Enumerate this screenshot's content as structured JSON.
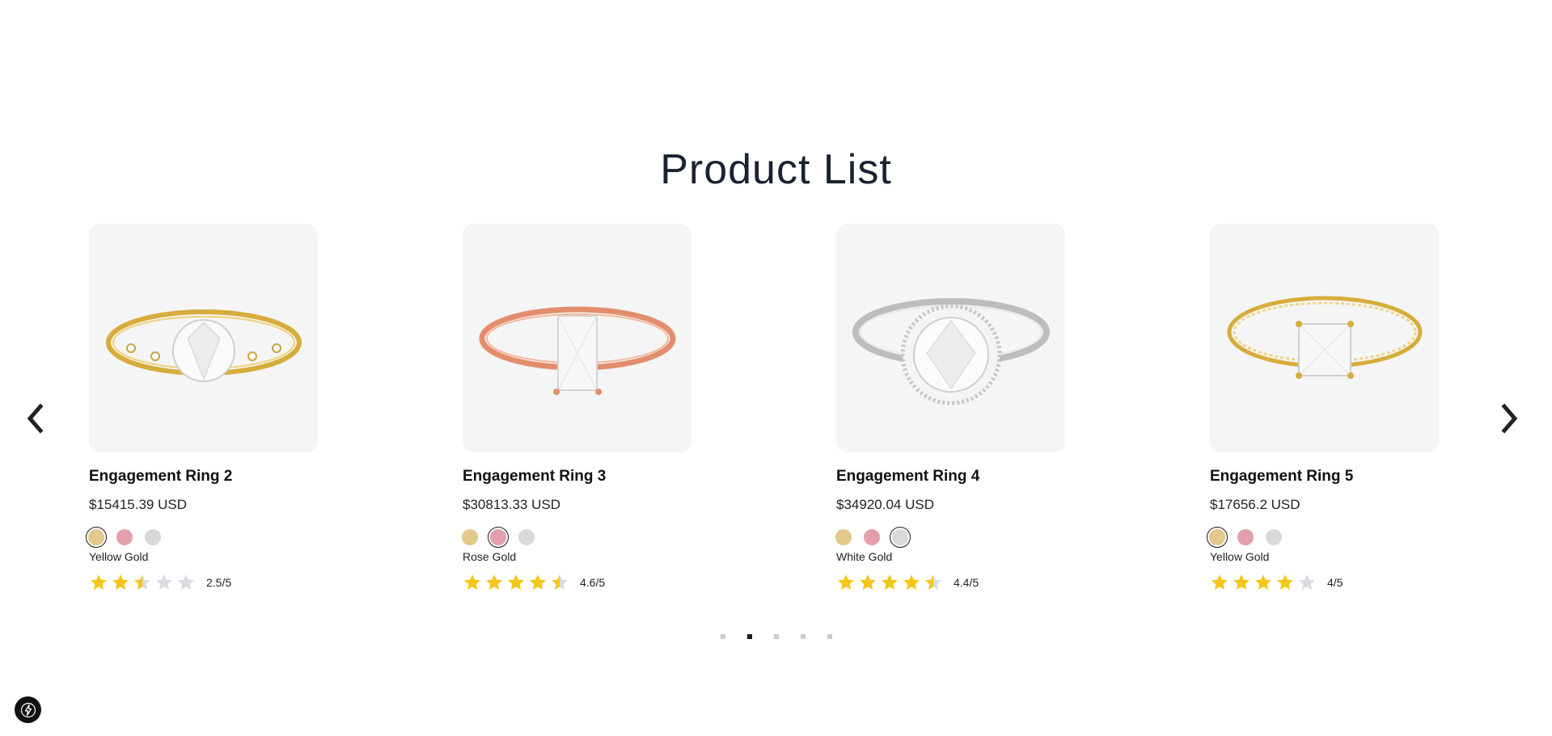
{
  "page": {
    "title": "Product List"
  },
  "colors": {
    "yellow_gold": "#e3c98a",
    "rose_gold": "#e3a0ab",
    "white_gold": "#d9d9d9",
    "star_filled": "#f5c518",
    "star_empty": "#d9dbe3"
  },
  "carousel": {
    "prev_icon": "chevron-left-icon",
    "next_icon": "chevron-right-icon",
    "page_count": 5,
    "active_page": 2
  },
  "products": [
    {
      "name": "Engagement Ring 2",
      "price": "$15415.39 USD",
      "metal_options": [
        "Yellow Gold",
        "Rose Gold",
        "White Gold"
      ],
      "selected_metal": "Yellow Gold",
      "rating": 2.5,
      "rating_text": "2.5/5"
    },
    {
      "name": "Engagement Ring 3",
      "price": "$30813.33 USD",
      "metal_options": [
        "Yellow Gold",
        "Rose Gold",
        "White Gold"
      ],
      "selected_metal": "Rose Gold",
      "rating": 4.6,
      "rating_text": "4.6/5"
    },
    {
      "name": "Engagement Ring 4",
      "price": "$34920.04 USD",
      "metal_options": [
        "Yellow Gold",
        "Rose Gold",
        "White Gold"
      ],
      "selected_metal": "White Gold",
      "rating": 4.4,
      "rating_text": "4.4/5"
    },
    {
      "name": "Engagement Ring 5",
      "price": "$17656.2 USD",
      "metal_options": [
        "Yellow Gold",
        "Rose Gold",
        "White Gold"
      ],
      "selected_metal": "Yellow Gold",
      "rating": 4,
      "rating_text": "4/5"
    }
  ],
  "widget": {
    "icon": "lightning-bolt-icon"
  }
}
